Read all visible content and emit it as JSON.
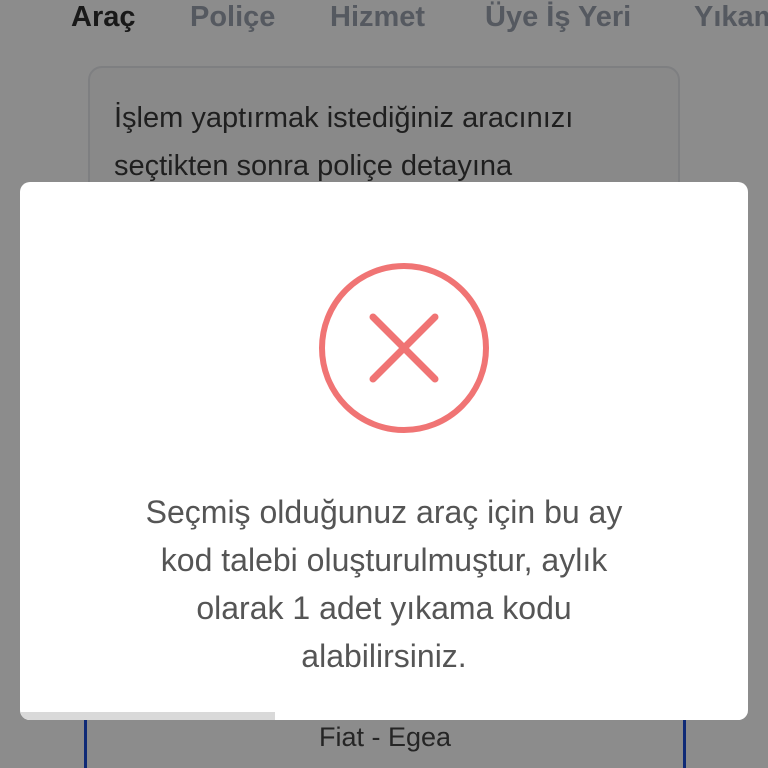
{
  "tabs": [
    {
      "label": "Araç",
      "active": true
    },
    {
      "label": "Poliçe",
      "active": false
    },
    {
      "label": "Hizmet",
      "active": false
    },
    {
      "label": "Üye İş Yeri",
      "active": false
    },
    {
      "label": "Yıkama",
      "active": false
    }
  ],
  "info": {
    "line1": "İşlem yaptırmak istediğiniz aracınızı",
    "line2": "seçtikten sonra poliçe detayına"
  },
  "vehicle": {
    "label": "Fiat - Egea"
  },
  "modal": {
    "icon": "error-x-circle-icon",
    "icon_color": "#f07474",
    "message_lines": [
      "Seçmiş olduğunuz araç için bu ay",
      "kod talebi oluşturulmuştur, aylık",
      "olarak 1 adet yıkama kodu",
      "alabilirsiniz."
    ],
    "timer_progress": 0.35
  },
  "colors": {
    "accent_blue": "#1d4ed8",
    "error_red": "#f07474",
    "tab_active": "#2f2f2f",
    "tab_inactive": "#9ca3af"
  }
}
